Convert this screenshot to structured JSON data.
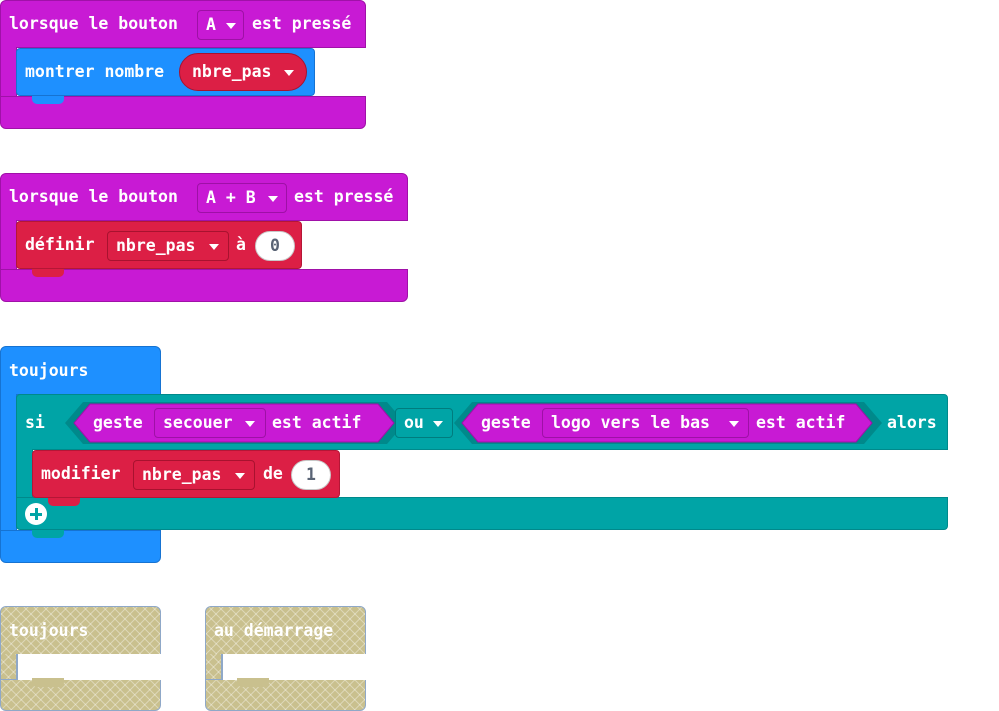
{
  "block1": {
    "hat_prefix": "lorsque le bouton",
    "button_value": "A",
    "hat_suffix": "est pressé",
    "inner_label": "montrer nombre",
    "variable": "nbre_pas"
  },
  "block2": {
    "hat_prefix": "lorsque le bouton",
    "button_value": "A + B",
    "hat_suffix": "est pressé",
    "inner_label": "définir",
    "variable": "nbre_pas",
    "to_label": "à",
    "value": "0"
  },
  "block3": {
    "hat_label": "toujours",
    "if_label": "si",
    "cond1_prefix": "geste",
    "cond1_value": "secouer",
    "cond1_suffix": "est actif",
    "op_value": "ou",
    "cond2_prefix": "geste",
    "cond2_value": "logo vers le bas",
    "cond2_suffix": "est actif",
    "then_label": "alors",
    "change_label": "modifier",
    "change_variable": "nbre_pas",
    "by_label": "de",
    "change_value": "1"
  },
  "disabled_blocks": {
    "forever_label": "toujours",
    "on_start_label": "au démarrage"
  },
  "colors": {
    "events": "#c81ad4",
    "basic": "#1e90ff",
    "variables": "#dc1f45",
    "logic": "#00a4a6",
    "disabled": "#c9c08e"
  }
}
